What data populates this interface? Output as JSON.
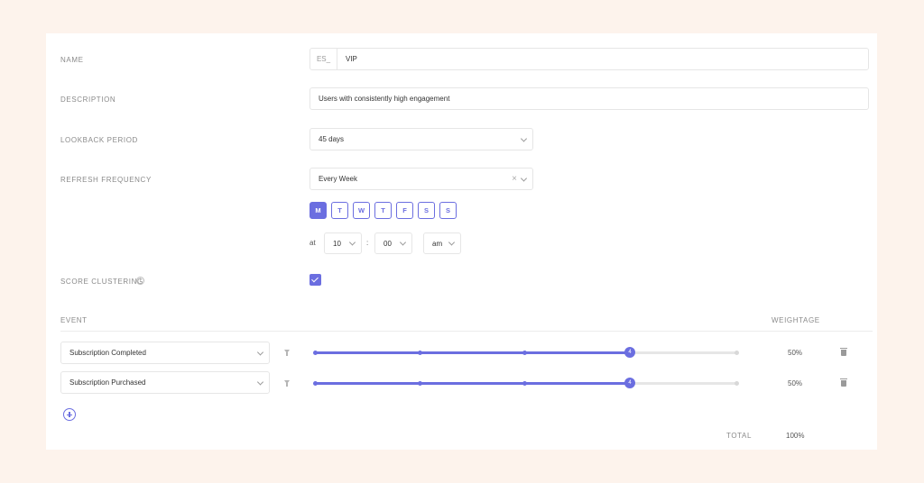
{
  "form": {
    "name_label": "NAME",
    "name_prefix": "ES_",
    "name_value": "VIP",
    "description_label": "DESCRIPTION",
    "description_value": "Users with consistently high engagement",
    "lookback_label": "LOOKBACK PERIOD",
    "lookback_value": "45 days",
    "refresh_label": "REFRESH FREQUENCY",
    "refresh_value": "Every Week",
    "refresh_clear": "×",
    "days": [
      "M",
      "T",
      "W",
      "T",
      "F",
      "S",
      "S"
    ],
    "active_day_index": 0,
    "at_label": "at",
    "hour_value": "10",
    "time_separator": ":",
    "minute_value": "00",
    "ampm_value": "am",
    "score_clustering_label": "SCORE CLUSTERING",
    "score_clustering_checked": true
  },
  "events": {
    "event_header": "EVENT",
    "weightage_header": "WEIGHTAGE",
    "rows": [
      {
        "event": "Subscription Completed",
        "slider_value": "4",
        "weightage": "50%"
      },
      {
        "event": "Subscription Purchased",
        "slider_value": "4",
        "weightage": "50%"
      }
    ],
    "total_label": "TOTAL",
    "total_value": "100%"
  },
  "colors": {
    "accent": "#6b6ee0",
    "background": "#fdf3ec",
    "card": "#ffffff"
  },
  "icons": [
    "chevron-down-icon",
    "clear-icon",
    "info-icon",
    "check-icon",
    "filter-icon",
    "trash-icon",
    "add-circle-icon"
  ]
}
